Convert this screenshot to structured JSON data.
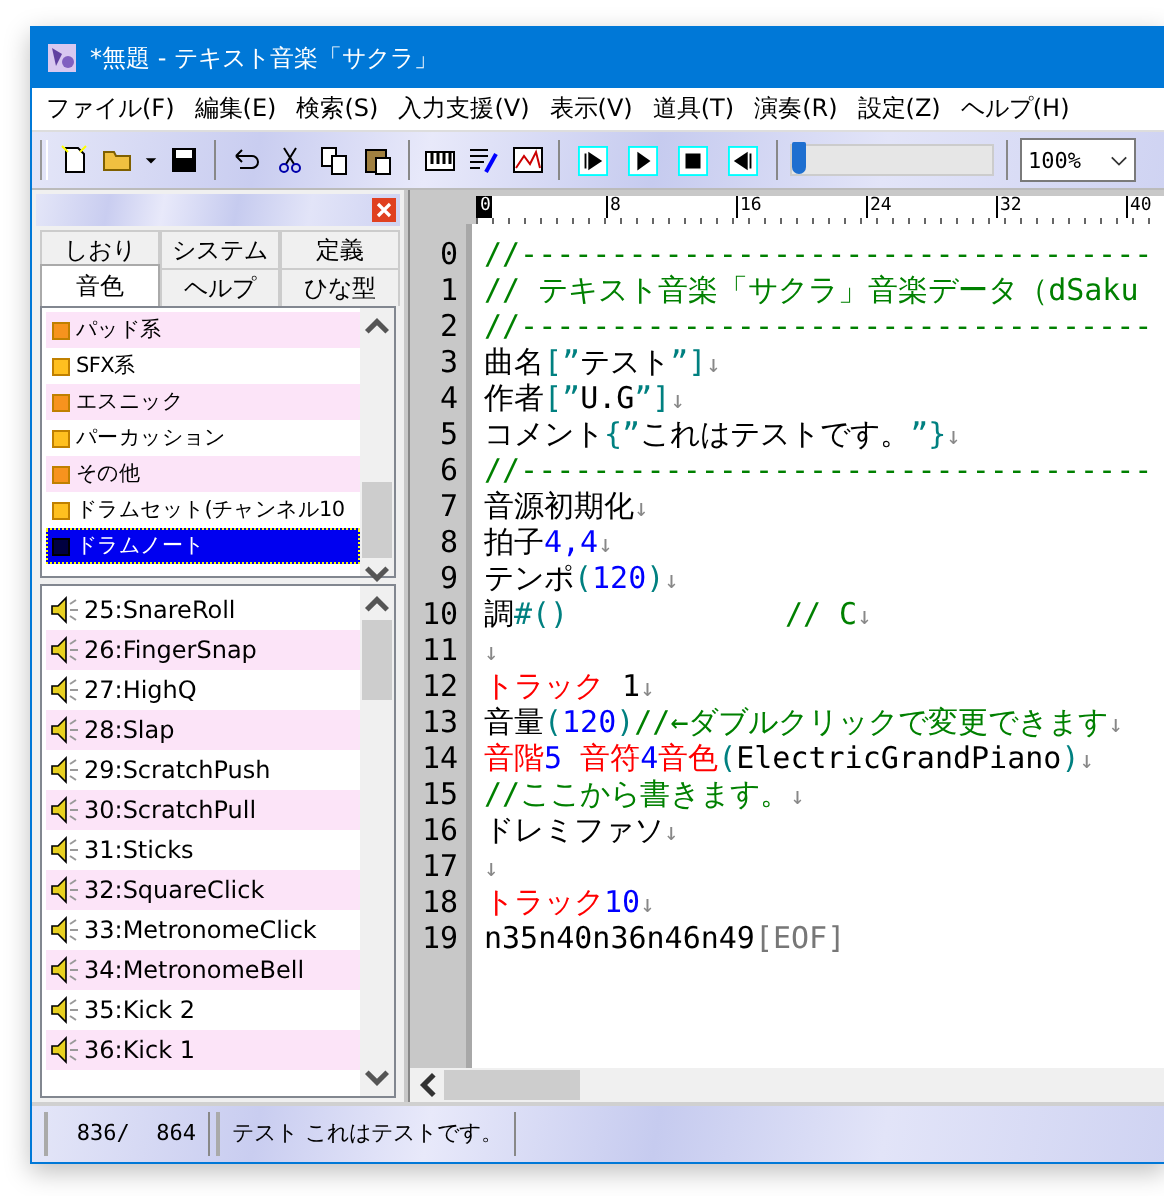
{
  "window": {
    "title": "*無題 - テキスト音楽「サクラ」"
  },
  "menu": [
    "ファイル(F)",
    "編集(E)",
    "検索(S)",
    "入力支援(V)",
    "表示(V)",
    "道具(T)",
    "演奏(R)",
    "設定(Z)",
    "ヘルプ(H)"
  ],
  "toolbar": {
    "position": {
      "level": 0
    },
    "zoom": "100%"
  },
  "side_panel": {
    "tab_rows": [
      [
        {
          "label": "しおり",
          "selected": false
        },
        {
          "label": "システム",
          "selected": false
        },
        {
          "label": "定義",
          "selected": false
        }
      ],
      [
        {
          "label": "音色",
          "selected": true
        },
        {
          "label": "ヘルプ",
          "selected": false
        },
        {
          "label": "ひな型",
          "selected": false
        }
      ]
    ],
    "categories": [
      {
        "label": "パッド系",
        "selected": false
      },
      {
        "label": "SFX系",
        "selected": false
      },
      {
        "label": "エスニック",
        "selected": false
      },
      {
        "label": "パーカッション",
        "selected": false
      },
      {
        "label": "その他",
        "selected": false
      },
      {
        "label": "ドラムセット(チャンネル10",
        "selected": false
      },
      {
        "label": "ドラムノート",
        "selected": true
      }
    ],
    "sounds": [
      "25:SnareRoll",
      "26:FingerSnap",
      "27:HighQ",
      "28:Slap",
      "29:ScratchPush",
      "30:ScratchPull",
      "31:Sticks",
      "32:SquareClick",
      "33:MetronomeClick",
      "34:MetronomeBell",
      "35:Kick 2",
      "36:Kick 1"
    ]
  },
  "editor": {
    "ruler": [
      "0",
      "8",
      "16",
      "24",
      "32",
      "40"
    ],
    "lines": [
      {
        "number": "0",
        "segments": [
          {
            "kind": "comment",
            "text": "//-----------------------------------"
          }
        ]
      },
      {
        "number": "1",
        "segments": [
          {
            "kind": "comment",
            "text": "// テキスト音楽「サクラ」音楽データ（dSaku"
          }
        ]
      },
      {
        "number": "2",
        "segments": [
          {
            "kind": "comment",
            "text": "//-----------------------------------"
          }
        ]
      },
      {
        "number": "3",
        "segments": [
          {
            "kind": "plain",
            "text": "曲名"
          },
          {
            "kind": "paren",
            "text": "[”"
          },
          {
            "kind": "plain",
            "text": "テスト"
          },
          {
            "kind": "paren",
            "text": "”]"
          },
          {
            "kind": "eol",
            "text": "↓"
          }
        ]
      },
      {
        "number": "4",
        "segments": [
          {
            "kind": "plain",
            "text": "作者"
          },
          {
            "kind": "paren",
            "text": "[”"
          },
          {
            "kind": "plain",
            "text": "U.G"
          },
          {
            "kind": "paren",
            "text": "”]"
          },
          {
            "kind": "eol",
            "text": "↓"
          }
        ]
      },
      {
        "number": "5",
        "segments": [
          {
            "kind": "plain",
            "text": "コメント"
          },
          {
            "kind": "paren",
            "text": "{”"
          },
          {
            "kind": "plain",
            "text": "これはテストです。"
          },
          {
            "kind": "paren",
            "text": "”}"
          },
          {
            "kind": "eol",
            "text": "↓"
          }
        ]
      },
      {
        "number": "6",
        "segments": [
          {
            "kind": "comment",
            "text": "//-----------------------------------"
          }
        ]
      },
      {
        "number": "7",
        "segments": [
          {
            "kind": "plain",
            "text": "音源初期化"
          },
          {
            "kind": "eol",
            "text": "↓"
          }
        ]
      },
      {
        "number": "8",
        "segments": [
          {
            "kind": "plain",
            "text": "拍子"
          },
          {
            "kind": "number",
            "text": "4,4"
          },
          {
            "kind": "eol",
            "text": "↓"
          }
        ]
      },
      {
        "number": "9",
        "segments": [
          {
            "kind": "plain",
            "text": "テンポ"
          },
          {
            "kind": "paren",
            "text": "("
          },
          {
            "kind": "number",
            "text": "120"
          },
          {
            "kind": "paren",
            "text": ")"
          },
          {
            "kind": "eol",
            "text": "↓"
          }
        ]
      },
      {
        "number": "10",
        "segments": [
          {
            "kind": "plain",
            "text": "調"
          },
          {
            "kind": "paren",
            "text": "#()"
          },
          {
            "kind": "comment",
            "text": "            // C"
          },
          {
            "kind": "eol",
            "text": "↓"
          }
        ]
      },
      {
        "number": "11",
        "segments": [
          {
            "kind": "eol",
            "text": "↓"
          }
        ]
      },
      {
        "number": "12",
        "segments": [
          {
            "kind": "keyword",
            "text": "トラック"
          },
          {
            "kind": "plain",
            "text": " 1"
          },
          {
            "kind": "eol",
            "text": "↓"
          }
        ]
      },
      {
        "number": "13",
        "segments": [
          {
            "kind": "plain",
            "text": "音量"
          },
          {
            "kind": "paren",
            "text": "("
          },
          {
            "kind": "number",
            "text": "120"
          },
          {
            "kind": "paren",
            "text": ")"
          },
          {
            "kind": "comment",
            "text": "//←ダブルクリックで変更できます"
          },
          {
            "kind": "eol",
            "text": "↓"
          }
        ]
      },
      {
        "number": "14",
        "segments": [
          {
            "kind": "keyword",
            "text": "音階"
          },
          {
            "kind": "number",
            "text": "5 "
          },
          {
            "kind": "keyword",
            "text": "音符"
          },
          {
            "kind": "number",
            "text": "4"
          },
          {
            "kind": "keyword",
            "text": "音色"
          },
          {
            "kind": "paren",
            "text": "("
          },
          {
            "kind": "plain",
            "text": "ElectricGrandPiano"
          },
          {
            "kind": "paren",
            "text": ")"
          },
          {
            "kind": "eol",
            "text": "↓"
          }
        ]
      },
      {
        "number": "15",
        "segments": [
          {
            "kind": "comment",
            "text": "//ここから書きます。"
          },
          {
            "kind": "eol",
            "text": "↓"
          }
        ]
      },
      {
        "number": "16",
        "segments": [
          {
            "kind": "plain",
            "text": "ドレミファソ"
          },
          {
            "kind": "eol",
            "text": "↓"
          }
        ]
      },
      {
        "number": "17",
        "segments": [
          {
            "kind": "eol",
            "text": "↓"
          }
        ]
      },
      {
        "number": "18",
        "segments": [
          {
            "kind": "keyword",
            "text": "トラック"
          },
          {
            "kind": "number",
            "text": "10"
          },
          {
            "kind": "eol",
            "text": "↓"
          }
        ]
      },
      {
        "number": "19",
        "segments": [
          {
            "kind": "plain",
            "text": "n35n40n36n46n49"
          },
          {
            "kind": "eof",
            "text": "[EOF]"
          }
        ]
      }
    ]
  },
  "status_bar": {
    "position": "836/  864",
    "message": "テスト これはテストです。"
  }
}
